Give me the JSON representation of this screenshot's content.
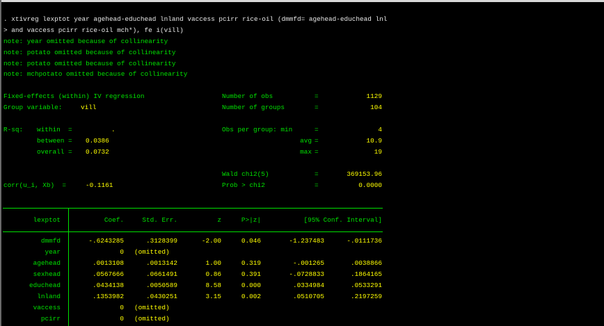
{
  "command": {
    "line1": ". xtivreg lexptot year agehead-educhead lnland vaccess pcirr rice-oil (dmmfd= agehead-educhead lnl",
    "line2": "> and vaccess pcirr rice-oil mch*), fe i(vill)"
  },
  "notes": [
    "note: year omitted because of collinearity",
    "note: potato omitted because of collinearity",
    "note: potato omitted because of collinearity",
    "note: mchpotato omitted because of collinearity"
  ],
  "summary": {
    "title": "Fixed-effects (within) IV regression",
    "group_label": "Group variable:",
    "group_value": "vill",
    "rsq_label": "R-sq:",
    "within_label": "within  =",
    "within_value": ".",
    "between_label": "between =",
    "between_value": "0.0386",
    "overall_label": "overall =",
    "overall_value": "0.0732",
    "corr_label": "corr(u_i, Xb)  =",
    "corr_value": "-0.1161",
    "stats": [
      {
        "label": "Number of obs",
        "eq": "=",
        "value": "1129"
      },
      {
        "label": "Number of groups",
        "eq": "=",
        "value": "104"
      },
      {
        "label": "Obs per group: min",
        "eq": "=",
        "value": "4"
      },
      {
        "label": "avg",
        "eq": "=",
        "value": "10.9"
      },
      {
        "label": "max",
        "eq": "=",
        "value": "19"
      },
      {
        "label": "Wald chi2(5)",
        "eq": "=",
        "value": "369153.96"
      },
      {
        "label": "Prob > chi2",
        "eq": "=",
        "value": "0.0000"
      }
    ]
  },
  "table": {
    "headers": [
      "lexptot",
      "Coef.",
      "Std. Err.",
      "z",
      "P>|z|",
      "[95% Conf. Interval]"
    ],
    "rows": [
      {
        "var": "dmmfd",
        "coef": "-.6243285",
        "se": ".3128399",
        "z": "-2.00",
        "p": "0.046",
        "lo": "-1.237483",
        "hi": "-.0111736"
      },
      {
        "var": "year",
        "coef": "0",
        "se": "(omitted)",
        "z": "",
        "p": "",
        "lo": "",
        "hi": ""
      },
      {
        "var": "agehead",
        "coef": ".0013108",
        "se": ".0013142",
        "z": "1.00",
        "p": "0.319",
        "lo": "-.001265",
        "hi": ".0038866"
      },
      {
        "var": "sexhead",
        "coef": ".0567666",
        "se": ".0661491",
        "z": "0.86",
        "p": "0.391",
        "lo": "-.0728833",
        "hi": ".1864165"
      },
      {
        "var": "educhead",
        "coef": ".0434138",
        "se": ".0050589",
        "z": "8.58",
        "p": "0.000",
        "lo": ".0334984",
        "hi": ".0533291"
      },
      {
        "var": "lnland",
        "coef": ".1353982",
        "se": ".0430251",
        "z": "3.15",
        "p": "0.002",
        "lo": ".0510705",
        "hi": ".2197259"
      },
      {
        "var": "vaccess",
        "coef": "0",
        "se": "(omitted)",
        "z": "",
        "p": "",
        "lo": "",
        "hi": ""
      },
      {
        "var": "pcirr",
        "coef": "0",
        "se": "(omitted)",
        "z": "",
        "p": "",
        "lo": "",
        "hi": ""
      }
    ]
  }
}
